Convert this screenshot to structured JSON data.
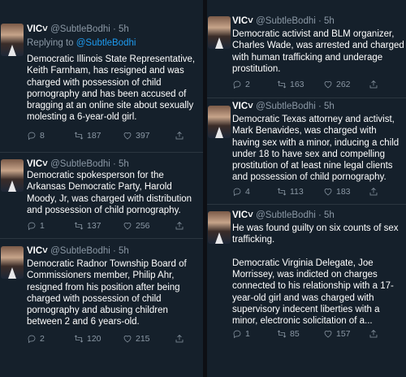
{
  "left": [
    {
      "name": "VIC",
      "verified": "˅",
      "handle": "@SubtleBodhi",
      "time": "· 5h",
      "reply_prefix": "Replying to ",
      "reply_to": "@SubtleBodhi",
      "text": "Democratic Illinois State Representative,\nKeith Farnham, has resigned and was\ncharged with possession of child\npornography and has been accused of\nbragging at an online site about sexually\nmolesting a 6-year-old girl.",
      "replies": "8",
      "retweets": "187",
      "likes": "397"
    },
    {
      "name": "VIC",
      "verified": "˅",
      "handle": "@SubtleBodhi",
      "time": "· 5h",
      "text": "Democratic spokesperson for the\nArkansas Democratic Party, Harold\nMoody, Jr, was charged with distribution\nand possession of child pornography.",
      "replies": "1",
      "retweets": "137",
      "likes": "256"
    },
    {
      "name": "VIC",
      "verified": "˅",
      "handle": "@SubtleBodhi",
      "time": "· 5h",
      "text": "Democratic Radnor Township Board of\nCommissioners member, Philip Ahr,\nresigned from his position after being\ncharged with possession of child\npornography and abusing children\nbetween 2 and 6 years-old.",
      "replies": "2",
      "retweets": "120",
      "likes": "215"
    }
  ],
  "right": [
    {
      "name": "VIC",
      "verified": "˅",
      "handle": "@SubtleBodhi",
      "time": "· 5h",
      "text": "Democratic activist and BLM organizer,\nCharles Wade, was arrested and charged\nwith human trafficking and underage\nprostitution.",
      "replies": "2",
      "retweets": "163",
      "likes": "262"
    },
    {
      "name": "VIC",
      "verified": "˅",
      "handle": "@SubtleBodhi",
      "time": "· 5h",
      "text": "Democratic Texas attorney and activist,\nMark Benavides, was charged with\nhaving sex with a minor, inducing a child\nunder 18 to have sex and compelling\nprostitution of at least nine legal clients\nand possession of child pornography.",
      "replies": "4",
      "retweets": "113",
      "likes": "183"
    },
    {
      "name": "VIC",
      "verified": "˅",
      "handle": "@SubtleBodhi",
      "time": "· 5h",
      "text": "He was found guilty on six counts of sex\ntrafficking.\n\nDemocratic Virginia Delegate, Joe\nMorrissey, was indicted on charges\nconnected to his relationship with a 17-\nyear-old girl and was charged with\nsupervisory indecent liberties with a\nminor, electronic solicitation of a...",
      "replies": "1",
      "retweets": "85",
      "likes": "157"
    }
  ]
}
